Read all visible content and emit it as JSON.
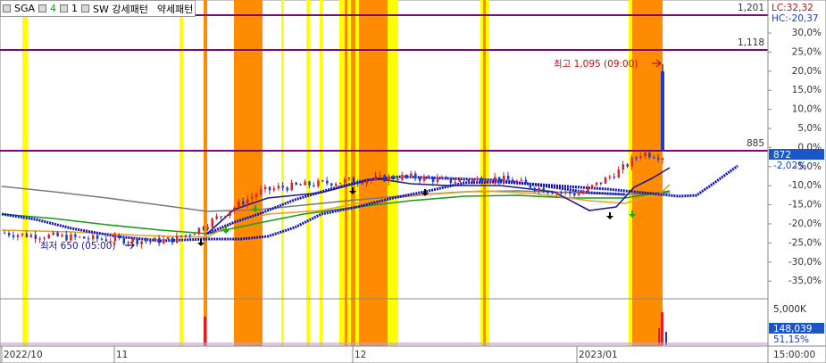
{
  "header": {
    "symbol": "SGA",
    "param1": "4",
    "param2": "1",
    "indicator": "SW 강세패턴",
    "indicator2": "약세패턴"
  },
  "hlines": [
    {
      "label": "1,201",
      "value": 1201
    },
    {
      "label": "1,118",
      "value": 1118
    },
    {
      "label": "885",
      "value": 885
    }
  ],
  "right_axis": {
    "lc_label": "LC:32,32",
    "hc_label": "HC:-20,37",
    "ticks": [
      "30,0%",
      "25,0%",
      "20,0%",
      "15,0%",
      "10,0%",
      "5,0%",
      "0,0%",
      "-5,0%",
      "-10,0%",
      "-15,0%",
      "-20,0%",
      "-25,0%",
      "-30,0%",
      "-35,0%"
    ],
    "current_price": "872",
    "current_pct": "-2,02%"
  },
  "annotations": {
    "high": "최고 1,095 (09:00)",
    "low": "최저 650 (05:00)"
  },
  "volume_axis": {
    "tick": "5,000K",
    "current_volume": "148,039",
    "current_pct": "51,15%"
  },
  "x_axis": [
    "2022/10",
    "11",
    "12",
    "2023/01",
    "15:00:00"
  ],
  "colors": {
    "candle_up": "#e02020",
    "candle_down": "#1a3cc8",
    "hline": "#7a0a7a",
    "band_yellow": "#ffff00",
    "band_orange": "#ff8c00",
    "bollinger": "#1010c0",
    "ma_gray": "#7a7a7a",
    "ma_green": "#1a9a1a",
    "ma_orange": "#e8a020",
    "ma_navy": "#1a1a8a"
  },
  "chart_data": {
    "type": "candlestick",
    "close_prices_approx": [
      695,
      690,
      688,
      685,
      682,
      680,
      678,
      676,
      680,
      700,
      730,
      760,
      790,
      800,
      805,
      810,
      815,
      818,
      822,
      825,
      820,
      815,
      818,
      822,
      815,
      800,
      790,
      785,
      810,
      840,
      880,
      872
    ],
    "high": 1095,
    "low": 650,
    "reference_levels": [
      1201,
      1118,
      885
    ]
  }
}
